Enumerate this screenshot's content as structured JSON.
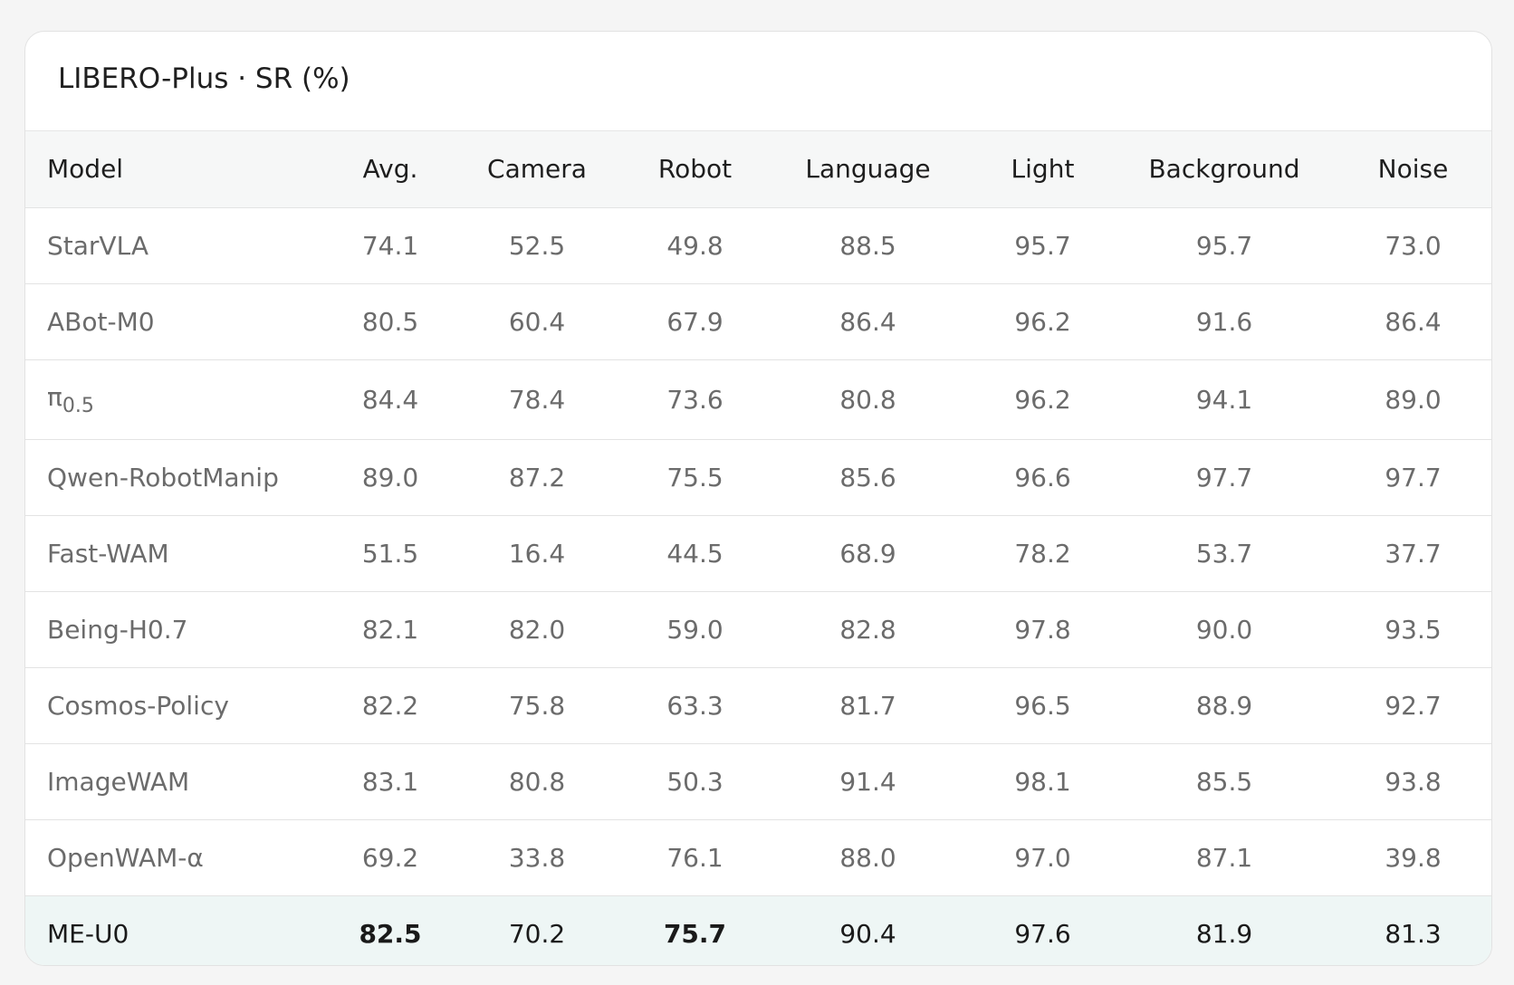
{
  "chart_data": {
    "type": "table",
    "title": "LIBERO-Plus · SR (%)",
    "columns": [
      "Model",
      "Avg.",
      "Camera",
      "Robot",
      "Language",
      "Light",
      "Background",
      "Noise"
    ],
    "rows": [
      {
        "model": "StarVLA",
        "values": [
          "74.1",
          "52.5",
          "49.8",
          "88.5",
          "95.7",
          "95.7",
          "73.0"
        ]
      },
      {
        "model": "ABot-M0",
        "values": [
          "80.5",
          "60.4",
          "67.9",
          "86.4",
          "96.2",
          "91.6",
          "86.4"
        ]
      },
      {
        "model": "π",
        "model_sub": "0.5",
        "values": [
          "84.4",
          "78.4",
          "73.6",
          "80.8",
          "96.2",
          "94.1",
          "89.0"
        ]
      },
      {
        "model": "Qwen-RobotManip",
        "values": [
          "89.0",
          "87.2",
          "75.5",
          "85.6",
          "96.6",
          "97.7",
          "97.7"
        ]
      },
      {
        "model": "Fast-WAM",
        "values": [
          "51.5",
          "16.4",
          "44.5",
          "68.9",
          "78.2",
          "53.7",
          "37.7"
        ]
      },
      {
        "model": "Being-H0.7",
        "values": [
          "82.1",
          "82.0",
          "59.0",
          "82.8",
          "97.8",
          "90.0",
          "93.5"
        ]
      },
      {
        "model": "Cosmos-Policy",
        "values": [
          "82.2",
          "75.8",
          "63.3",
          "81.7",
          "96.5",
          "88.9",
          "92.7"
        ]
      },
      {
        "model": "ImageWAM",
        "values": [
          "83.1",
          "80.8",
          "50.3",
          "91.4",
          "98.1",
          "85.5",
          "93.8"
        ]
      },
      {
        "model": "OpenWAM-α",
        "values": [
          "69.2",
          "33.8",
          "76.1",
          "88.0",
          "97.0",
          "87.1",
          "39.8"
        ]
      },
      {
        "model": "ME-U0",
        "values": [
          "82.5",
          "70.2",
          "75.7",
          "90.4",
          "97.6",
          "81.9",
          "81.3"
        ],
        "highlight": true,
        "bold_columns": [
          0,
          2
        ]
      }
    ],
    "colors": {
      "highlight_row": "#eef6f5",
      "header_bg": "#f6f7f7",
      "text_muted": "#6b6b6b",
      "text_strong": "#1a1a1a"
    }
  }
}
